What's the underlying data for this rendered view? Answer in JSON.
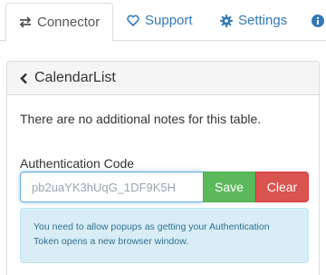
{
  "tabs": [
    {
      "label": "Connector",
      "icon": "exchange-icon",
      "active": true
    },
    {
      "label": "Support",
      "icon": "heart-icon",
      "active": false
    },
    {
      "label": "Settings",
      "icon": "gear-icon",
      "active": false
    },
    {
      "label": "",
      "icon": "info-icon",
      "active": false
    }
  ],
  "panel": {
    "title": "CalendarList",
    "note": "There are no additional notes for this table.",
    "auth": {
      "label": "Authentication Code",
      "value": "pb2uaYK3hUqG_1DF9K5H",
      "save_label": "Save",
      "clear_label": "Clear"
    },
    "info": "You need to allow popups as getting your Authentication Token opens a new browser window."
  },
  "colors": {
    "link": "#337ab7",
    "save": "#5cb85c",
    "clear": "#d9534f",
    "info_bg": "#d9edf7",
    "info_text": "#31708f"
  }
}
